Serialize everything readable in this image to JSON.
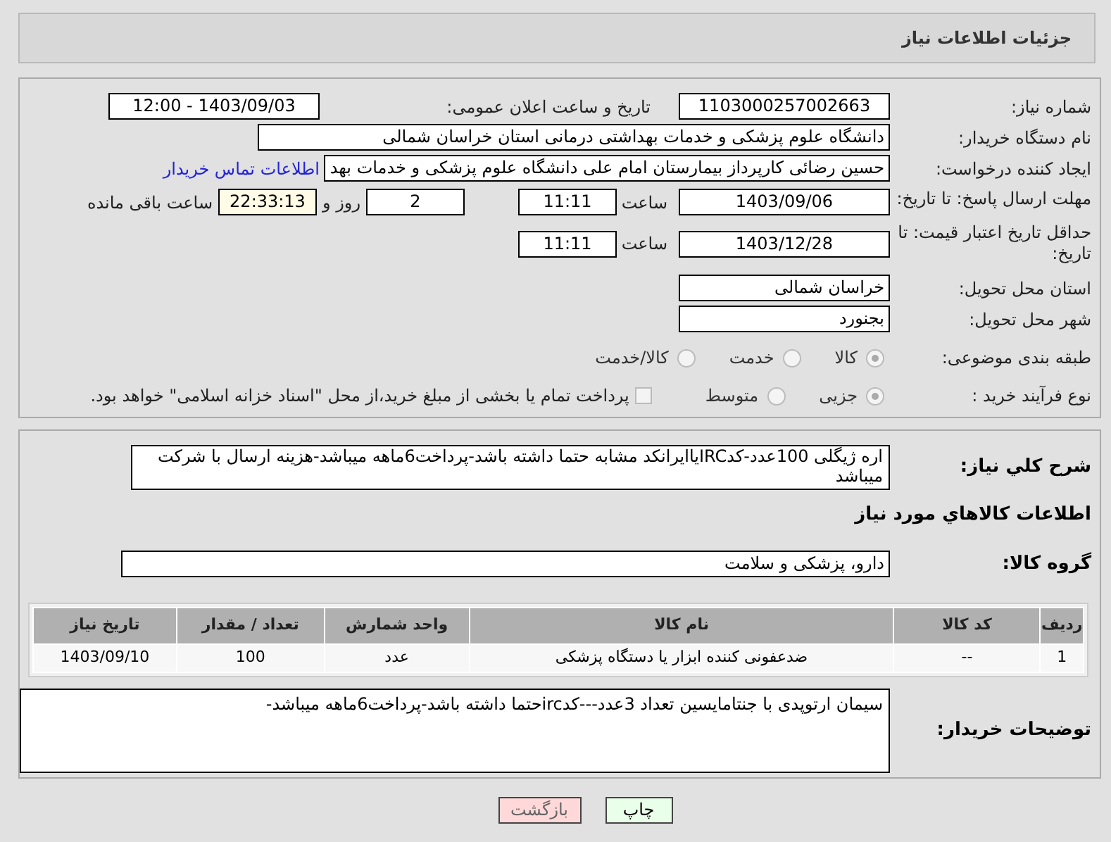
{
  "header": {
    "title": "جزئیات اطلاعات نیاز"
  },
  "details": {
    "need_number": {
      "label": "شماره نیاز:",
      "value": "1103000257002663"
    },
    "announce": {
      "label": "تاریخ و ساعت اعلان عمومی:",
      "value": "1403/09/03 - 12:00"
    },
    "buyer_org": {
      "label": "نام دستگاه خریدار:",
      "value": "دانشگاه علوم پزشکی و خدمات بهداشتی درمانی استان خراسان شمالی"
    },
    "requester": {
      "label": "ایجاد کننده درخواست:",
      "value": "حسین رضائی کارپرداز بیمارستان امام علی دانشگاه علوم پزشکی و خدمات بهد",
      "link": "اطلاعات تماس خریدار"
    },
    "reply_deadline": {
      "label": "مهلت ارسال پاسخ: تا تاریخ:",
      "date": "1403/09/06",
      "time_label": "ساعت",
      "time": "11:11",
      "days": "2",
      "days_label": "روز و",
      "remaining": "22:33:13",
      "remaining_label": "ساعت باقی مانده"
    },
    "price_validity": {
      "label": "حداقل تاریخ اعتبار قیمت: تا تاریخ:",
      "date": "1403/12/28",
      "time_label": "ساعت",
      "time": "11:11"
    },
    "province": {
      "label": "استان محل تحویل:",
      "value": "خراسان شمالی"
    },
    "city": {
      "label": "شهر محل تحویل:",
      "value": "بجنورد"
    },
    "category": {
      "label": "طبقه بندی موضوعی:",
      "options": [
        {
          "label": "کالا",
          "selected": true
        },
        {
          "label": "خدمت",
          "selected": false
        },
        {
          "label": "کالا/خدمت",
          "selected": false
        }
      ]
    },
    "process": {
      "label": "نوع فرآیند خرید :",
      "options": [
        {
          "label": "جزیی",
          "selected": true
        },
        {
          "label": "متوسط",
          "selected": false
        }
      ],
      "payment_note": {
        "checked": false,
        "text": "پرداخت تمام یا بخشی از مبلغ خرید،از محل \"اسناد خزانه اسلامی\" خواهد بود."
      }
    }
  },
  "goods": {
    "description": {
      "label": "شرح کلي نياز:",
      "value": "اره ژیگلی 100عدد-کدIRCیاایرانکد مشابه حتما داشته باشد-پرداخت6ماهه میباشد-هزینه ارسال با شرکت میباشد"
    },
    "heading": "اطلاعات کالاهاي مورد نياز",
    "group": {
      "label": "گروه کالا:",
      "value": "دارو، پزشکی و سلامت"
    },
    "table": {
      "columns": [
        "ردیف",
        "کد کالا",
        "نام کالا",
        "واحد شمارش",
        "تعداد / مقدار",
        "تاریخ نیاز"
      ],
      "rows": [
        [
          "1",
          "--",
          "ضدعفونی کننده ابزار یا دستگاه پزشکی",
          "عدد",
          "100",
          "1403/09/10"
        ]
      ]
    },
    "buyer_notes": {
      "label": "توضیحات خریدار:",
      "value": "سیمان ارتوپدی با جنتامایسین تعداد 3عدد---کدircحتما داشته باشد-پرداخت6ماهه میباشد-"
    }
  },
  "buttons": [
    {
      "label": "چاپ",
      "kind": "print"
    },
    {
      "label": "بازگشت",
      "kind": "back"
    }
  ]
}
